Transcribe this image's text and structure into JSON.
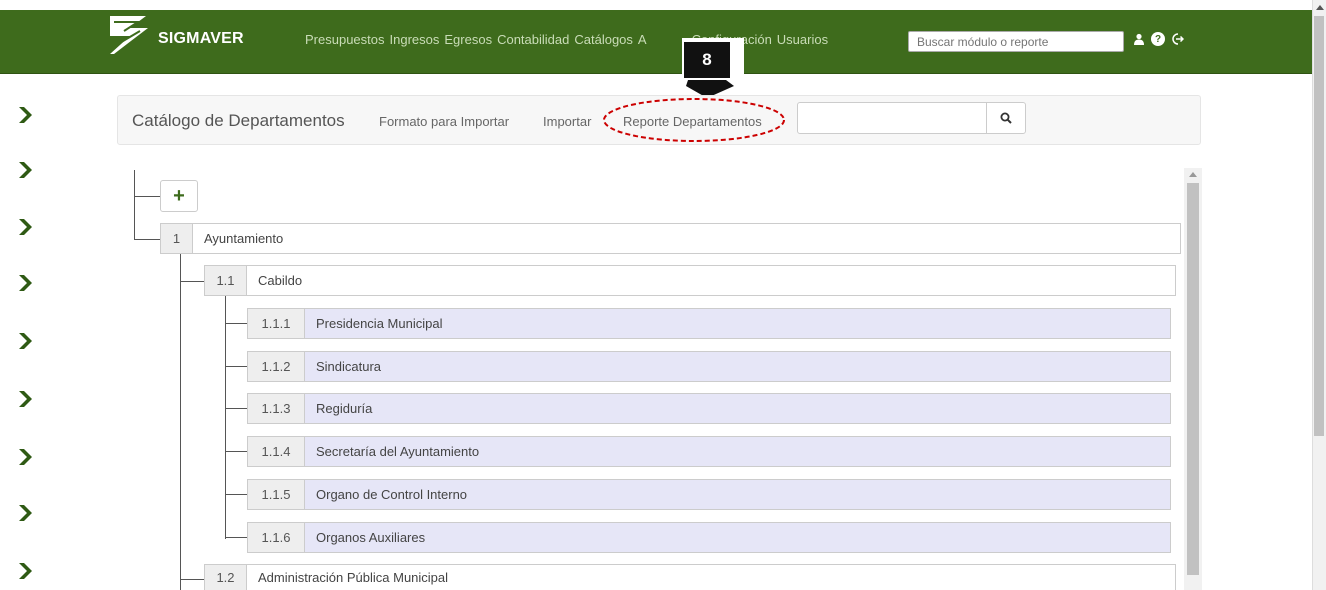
{
  "app": {
    "brand": "SIGMAVER"
  },
  "nav": {
    "items": [
      "Presupuestos",
      "Ingresos",
      "Egresos",
      "Contabilidad",
      "Catálogos",
      "A",
      "Configuración",
      "Usuarios"
    ],
    "search_placeholder": "Buscar módulo o reporte",
    "icons": [
      "user-icon",
      "help-icon",
      "logout-icon"
    ]
  },
  "callout": {
    "number": "8"
  },
  "catalog": {
    "title": "Catálogo de Departamentos",
    "links": {
      "format": "Formato para Importar",
      "import": "Importar",
      "report": "Reporte Departamentos"
    },
    "search_value": ""
  },
  "tree": {
    "add_label": "+",
    "nodes": [
      {
        "num": "1",
        "label": "Ayuntamiento"
      },
      {
        "num": "1.1",
        "label": "Cabildo"
      },
      {
        "num": "1.1.1",
        "label": "Presidencia Municipal"
      },
      {
        "num": "1.1.2",
        "label": "Sindicatura"
      },
      {
        "num": "1.1.3",
        "label": "Regiduría"
      },
      {
        "num": "1.1.4",
        "label": "Secretaría del Ayuntamiento"
      },
      {
        "num": "1.1.5",
        "label": "Organo de Control Interno"
      },
      {
        "num": "1.1.6",
        "label": "Organos Auxiliares"
      },
      {
        "num": "1.2",
        "label": "Administración Pública Municipal"
      }
    ]
  },
  "colors": {
    "navbar": "#3e6b1c",
    "leaf_bg": "#e6e6f7",
    "callout_ring": "#cc0000"
  }
}
